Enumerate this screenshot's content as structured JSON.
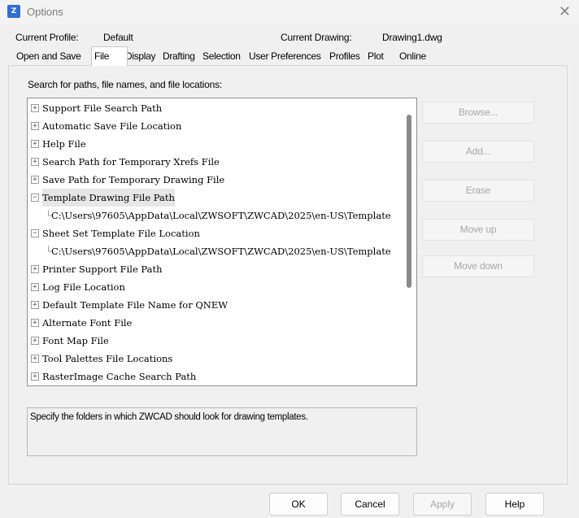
{
  "window": {
    "title": "Options",
    "app_icon": "zwcad-app-icon",
    "close_glyph": "✕"
  },
  "info": {
    "profile_label": "Current Profile:",
    "profile_value": "Default",
    "drawing_label": "Current Drawing:",
    "drawing_value": "Drawing1.dwg"
  },
  "tabs": [
    {
      "label": "Open and Save"
    },
    {
      "label": "File",
      "active": true
    },
    {
      "label": "Display"
    },
    {
      "label": "Drafting"
    },
    {
      "label": "Selection"
    },
    {
      "label": "User Preferences"
    },
    {
      "label": "Profiles"
    },
    {
      "label": "Plot"
    },
    {
      "label": "Online"
    }
  ],
  "file_tab": {
    "section_label": "Search for paths, file names, and file locations:",
    "tree": [
      {
        "label": "Support File Search Path",
        "expanded": false
      },
      {
        "label": "Automatic Save File Location",
        "expanded": false
      },
      {
        "label": "Help File",
        "expanded": false
      },
      {
        "label": "Search Path for Temporary Xrefs File",
        "expanded": false
      },
      {
        "label": "Save Path for Temporary Drawing File",
        "expanded": false
      },
      {
        "label": "Template Drawing File Path",
        "expanded": true,
        "selected": true,
        "child": "C:\\Users\\97605\\AppData\\Local\\ZWSOFT\\ZWCAD\\2025\\en-US\\Template"
      },
      {
        "label": "Sheet Set Template File Location",
        "expanded": true,
        "child": "C:\\Users\\97605\\AppData\\Local\\ZWSOFT\\ZWCAD\\2025\\en-US\\Template"
      },
      {
        "label": "Printer Support File Path",
        "expanded": false
      },
      {
        "label": "Log File Location",
        "expanded": false
      },
      {
        "label": "Default Template File Name for QNEW",
        "expanded": false
      },
      {
        "label": "Alternate Font File",
        "expanded": false
      },
      {
        "label": "Font Map File",
        "expanded": false
      },
      {
        "label": "Tool Palettes File Locations",
        "expanded": false
      },
      {
        "label": "RasterImage Cache Search Path",
        "expanded": false
      }
    ],
    "side_buttons": {
      "browse": "Browse...",
      "add": "Add...",
      "erase": "Erase",
      "move_up": "Move up",
      "move_down": "Move down"
    },
    "description": "Specify the folders in which ZWCAD should look for drawing templates."
  },
  "footer": {
    "ok": "OK",
    "cancel": "Cancel",
    "apply": "Apply",
    "help": "Help"
  },
  "colors": {
    "dialog_bg": "#f0f0f0",
    "disabled_text": "#a8a8a8",
    "app_icon_blue": "#2f6ed3"
  }
}
